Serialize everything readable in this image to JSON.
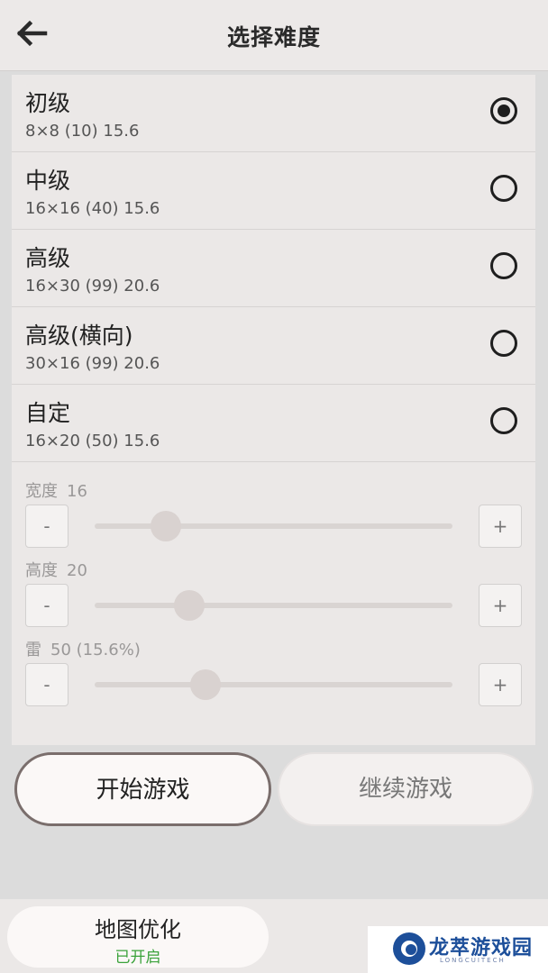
{
  "header": {
    "title": "选择难度",
    "back_icon": "arrow-left-icon"
  },
  "difficulty_options": [
    {
      "title": "初级",
      "detail": "8×8 (10) 15.6",
      "selected": true
    },
    {
      "title": "中级",
      "detail": "16×16 (40) 15.6",
      "selected": false
    },
    {
      "title": "高级",
      "detail": "16×30 (99) 20.6",
      "selected": false
    },
    {
      "title": "高级(横向)",
      "detail": "30×16 (99) 20.6",
      "selected": false
    },
    {
      "title": "自定",
      "detail": "16×20 (50) 15.6",
      "selected": false
    }
  ],
  "custom": {
    "width": {
      "label": "宽度",
      "value": "16",
      "level": 0.2
    },
    "height": {
      "label": "高度",
      "value": "20",
      "level": 0.265
    },
    "mines": {
      "label": "雷",
      "value": "50 (15.6%)",
      "level": 0.31
    },
    "minus_label": "-",
    "plus_label": "+"
  },
  "actions": {
    "start": "开始游戏",
    "continue": "继续游戏"
  },
  "map_optimization": {
    "title": "地图优化",
    "status": "已开启"
  },
  "watermark": {
    "name": "龙萃游戏园",
    "sub": "LONGCUITECH"
  },
  "colors": {
    "status_green": "#3aa23a",
    "start_border": "#7a6e6c",
    "watermark_blue": "#1d4f9a"
  }
}
